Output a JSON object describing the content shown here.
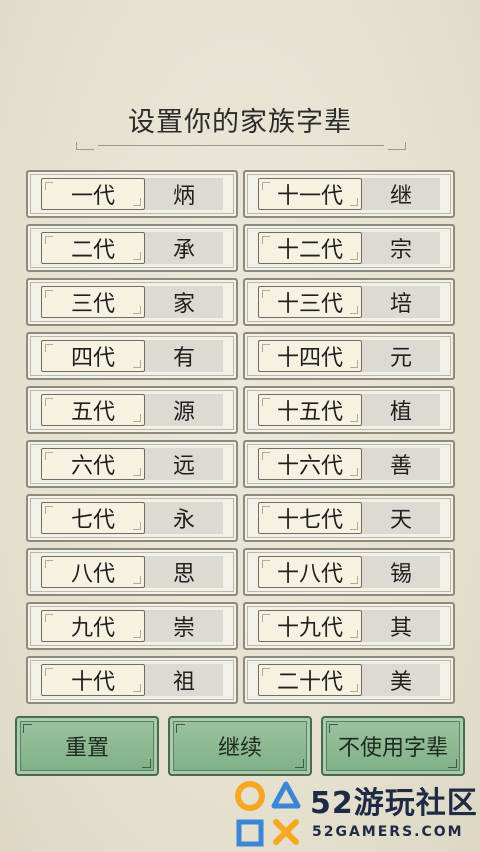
{
  "title": "设置你的家族字辈",
  "generations_left": [
    {
      "label": "一代",
      "value": "炳"
    },
    {
      "label": "二代",
      "value": "承"
    },
    {
      "label": "三代",
      "value": "家"
    },
    {
      "label": "四代",
      "value": "有"
    },
    {
      "label": "五代",
      "value": "源"
    },
    {
      "label": "六代",
      "value": "远"
    },
    {
      "label": "七代",
      "value": "永"
    },
    {
      "label": "八代",
      "value": "思"
    },
    {
      "label": "九代",
      "value": "崇"
    },
    {
      "label": "十代",
      "value": "祖"
    }
  ],
  "generations_right": [
    {
      "label": "十一代",
      "value": "继"
    },
    {
      "label": "十二代",
      "value": "宗"
    },
    {
      "label": "十三代",
      "value": "培"
    },
    {
      "label": "十四代",
      "value": "元"
    },
    {
      "label": "十五代",
      "value": "植"
    },
    {
      "label": "十六代",
      "value": "善"
    },
    {
      "label": "十七代",
      "value": "天"
    },
    {
      "label": "十八代",
      "value": "锡"
    },
    {
      "label": "十九代",
      "value": "其"
    },
    {
      "label": "二十代",
      "value": "美"
    }
  ],
  "buttons": {
    "reset": "重置",
    "continue": "继续",
    "skip": "不使用字辈"
  },
  "watermark": {
    "title": "52游玩社区",
    "subtitle": "52GAMERS.COM"
  },
  "colors": {
    "background": "#e7e2d2",
    "button_green": "#8fbb95",
    "watermark_orange": "#f6a821",
    "watermark_blue": "#3b86d6"
  }
}
